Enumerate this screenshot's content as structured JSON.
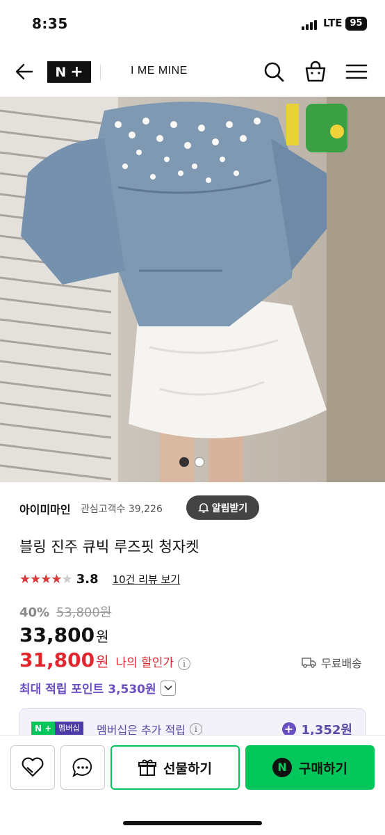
{
  "status_bar": {
    "time": "8:35",
    "network": "LTE",
    "battery": "95"
  },
  "header": {
    "logo_n": "N",
    "logo_plus": "+",
    "shop_name": "I ME MINE"
  },
  "store": {
    "name": "아이미마인",
    "interest_label": "관심고객수",
    "interest_count": "39,226",
    "notify_label": "알림받기"
  },
  "product": {
    "title": "블링 진주 큐빅 루즈핏 청자켓",
    "rating": 3.8,
    "rating_text": "3.8",
    "review_link": "10건 리뷰 보기",
    "discount_pct": "40%",
    "original_price": "53,800원",
    "price": "33,800",
    "my_price": "31,800",
    "won": "원",
    "my_price_label": "나의 할인가",
    "shipping": "무료배송",
    "points_text": "최대 적립 포인트 3,530원"
  },
  "membership": {
    "badge_n": "N",
    "badge_plus": "+",
    "badge_label": "멤버십",
    "text": "멤버십은 추가 적립",
    "points": "1,352원"
  },
  "carousel": {
    "active_index": 0,
    "count": 2
  },
  "bottom_bar": {
    "gift_label": "선물하기",
    "buy_label": "구매하기",
    "buy_badge": "N"
  },
  "colors": {
    "naver_green": "#03c75a",
    "discount_red": "#e0262e",
    "points_purple": "#6b4fc1",
    "star_red": "#d63a3a"
  }
}
